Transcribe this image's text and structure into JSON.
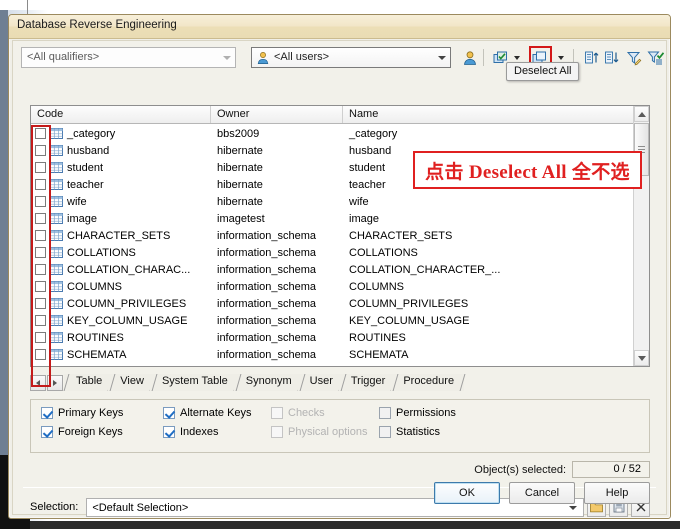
{
  "window": {
    "title": "Database Reverse Engineering"
  },
  "toolbar": {
    "qualifiers": {
      "value": "<All qualifiers>",
      "icon": "chevron-down-icon"
    },
    "users": {
      "value": "<All users>",
      "icon": "user-icon"
    },
    "buttons": [
      {
        "name": "user-filter-button",
        "icon": "user-icon"
      },
      {
        "name": "select-all-button",
        "icon": "select-all-icon"
      },
      {
        "name": "select-all-dropdown",
        "icon": "chevron-down-icon"
      },
      {
        "name": "deselect-all-button",
        "icon": "deselect-all-icon",
        "highlighted": true
      },
      {
        "name": "deselect-all-dropdown",
        "icon": "chevron-down-icon"
      },
      {
        "name": "sort-ascending-button",
        "icon": "sort-ascending-icon"
      },
      {
        "name": "sort-descending-button",
        "icon": "sort-descending-icon"
      },
      {
        "name": "edit-filter-button",
        "icon": "filter-edit-icon"
      },
      {
        "name": "apply-filter-button",
        "icon": "filter-apply-icon"
      }
    ],
    "tooltip": "Deselect All"
  },
  "annotation": {
    "text": "点击 Deselect All 全不选",
    "color": "#e02020"
  },
  "grid": {
    "columns": [
      "Code",
      "Owner",
      "Name"
    ],
    "rows": [
      {
        "code": "_category",
        "owner": "bbs2009",
        "name": "_category",
        "checked": false
      },
      {
        "code": "husband",
        "owner": "hibernate",
        "name": "husband",
        "checked": false
      },
      {
        "code": "student",
        "owner": "hibernate",
        "name": "student",
        "checked": false
      },
      {
        "code": "teacher",
        "owner": "hibernate",
        "name": "teacher",
        "checked": false
      },
      {
        "code": "wife",
        "owner": "hibernate",
        "name": "wife",
        "checked": false
      },
      {
        "code": "image",
        "owner": "imagetest",
        "name": "image",
        "checked": false
      },
      {
        "code": "CHARACTER_SETS",
        "owner": "information_schema",
        "name": "CHARACTER_SETS",
        "checked": false
      },
      {
        "code": "COLLATIONS",
        "owner": "information_schema",
        "name": "COLLATIONS",
        "checked": false
      },
      {
        "code": "COLLATION_CHARAC...",
        "owner": "information_schema",
        "name": "COLLATION_CHARACTER_...",
        "checked": false
      },
      {
        "code": "COLUMNS",
        "owner": "information_schema",
        "name": "COLUMNS",
        "checked": false
      },
      {
        "code": "COLUMN_PRIVILEGES",
        "owner": "information_schema",
        "name": "COLUMN_PRIVILEGES",
        "checked": false
      },
      {
        "code": "KEY_COLUMN_USAGE",
        "owner": "information_schema",
        "name": "KEY_COLUMN_USAGE",
        "checked": false
      },
      {
        "code": "ROUTINES",
        "owner": "information_schema",
        "name": "ROUTINES",
        "checked": false
      },
      {
        "code": "SCHEMATA",
        "owner": "information_schema",
        "name": "SCHEMATA",
        "checked": false
      }
    ]
  },
  "tabs": [
    {
      "label": "Table",
      "active": true
    },
    {
      "label": "View",
      "active": false
    },
    {
      "label": "System Table",
      "active": false
    },
    {
      "label": "Synonym",
      "active": false
    },
    {
      "label": "User",
      "active": false
    },
    {
      "label": "Trigger",
      "active": false
    },
    {
      "label": "Procedure",
      "active": false
    }
  ],
  "options": [
    {
      "label": "Primary Keys",
      "checked": true,
      "enabled": true
    },
    {
      "label": "Foreign Keys",
      "checked": true,
      "enabled": true
    },
    {
      "label": "Alternate Keys",
      "checked": true,
      "enabled": true
    },
    {
      "label": "Indexes",
      "checked": true,
      "enabled": true
    },
    {
      "label": "Checks",
      "checked": false,
      "enabled": false
    },
    {
      "label": "Physical options",
      "checked": false,
      "enabled": false
    },
    {
      "label": "Permissions",
      "checked": false,
      "enabled": true
    },
    {
      "label": "Statistics",
      "checked": false,
      "enabled": true
    }
  ],
  "status": {
    "objects_label": "Object(s) selected:",
    "objects_value": "0 / 52"
  },
  "selection": {
    "label": "Selection:",
    "value": "<Default Selection>",
    "buttons": [
      {
        "name": "open-selection-button",
        "icon": "folder-icon"
      },
      {
        "name": "save-selection-button",
        "icon": "save-icon"
      },
      {
        "name": "delete-selection-button",
        "icon": "close-icon"
      }
    ]
  },
  "footer": {
    "ok": "OK",
    "cancel": "Cancel",
    "help": "Help"
  }
}
